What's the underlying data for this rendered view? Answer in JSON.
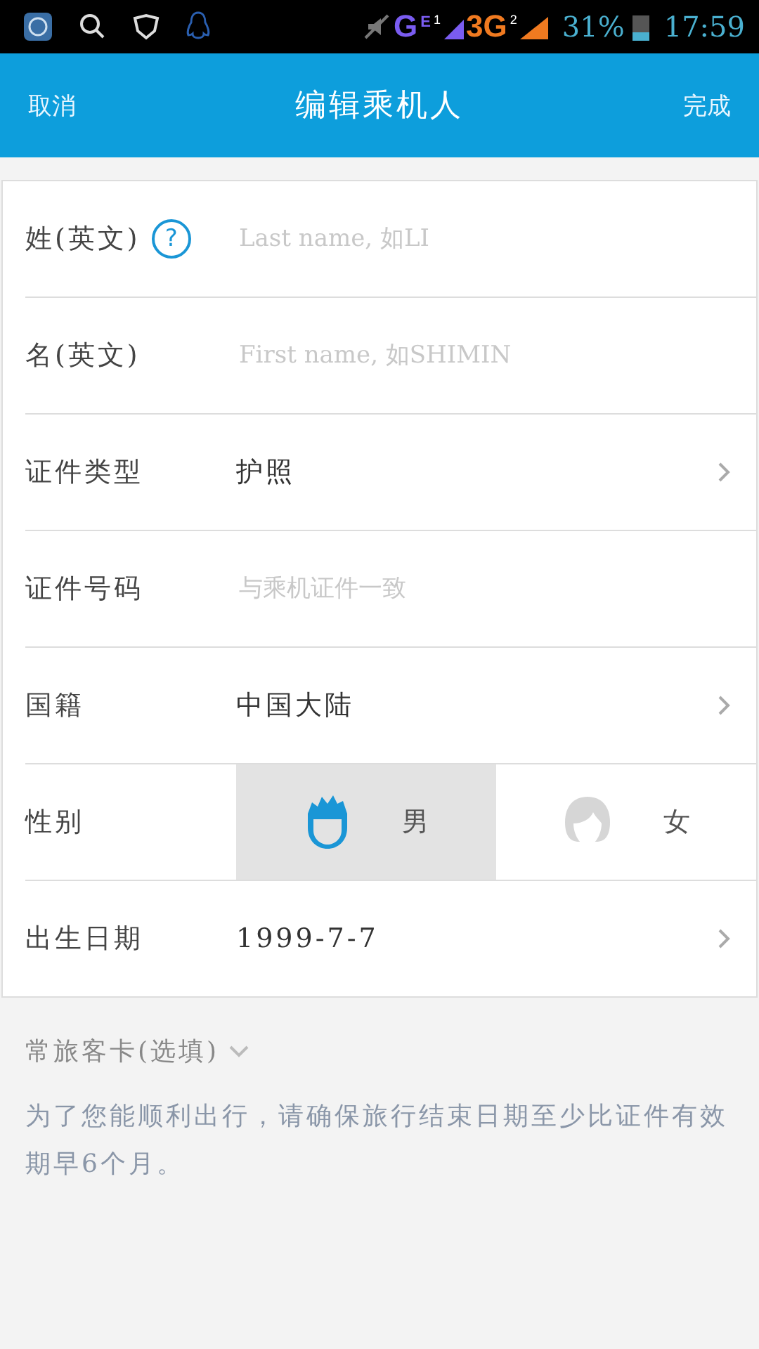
{
  "status_bar": {
    "network_g": "G",
    "network_e": "E",
    "sim_1": "1",
    "network_3g": "3G",
    "sim_2": "2",
    "battery": "31%",
    "time": "17:59"
  },
  "header": {
    "cancel": "取消",
    "title": "编辑乘机人",
    "done": "完成"
  },
  "rows": [
    {
      "kind": "input",
      "label": "姓(英文)",
      "help": "?",
      "placeholder": "Last name, 如LI"
    },
    {
      "kind": "input",
      "label": "名(英文)",
      "placeholder": "First name, 如SHIMIN"
    },
    {
      "kind": "select",
      "label": "证件类型",
      "value": "护照"
    },
    {
      "kind": "input",
      "label": "证件号码",
      "placeholder": "与乘机证件一致"
    },
    {
      "kind": "select",
      "label": "国籍",
      "value": "中国大陆"
    },
    {
      "kind": "gender",
      "label": "性别",
      "options": [
        {
          "label": "男",
          "kind": "male",
          "selected": true
        },
        {
          "label": "女",
          "kind": "female",
          "selected": false
        }
      ]
    },
    {
      "kind": "select",
      "label": "出生日期",
      "value": "1999-7-7"
    }
  ],
  "frequent_flyer": "常旅客卡(选填)",
  "note": "为了您能顺利出行，请确保旅行结束日期至少比证件有效期早6个月。"
}
